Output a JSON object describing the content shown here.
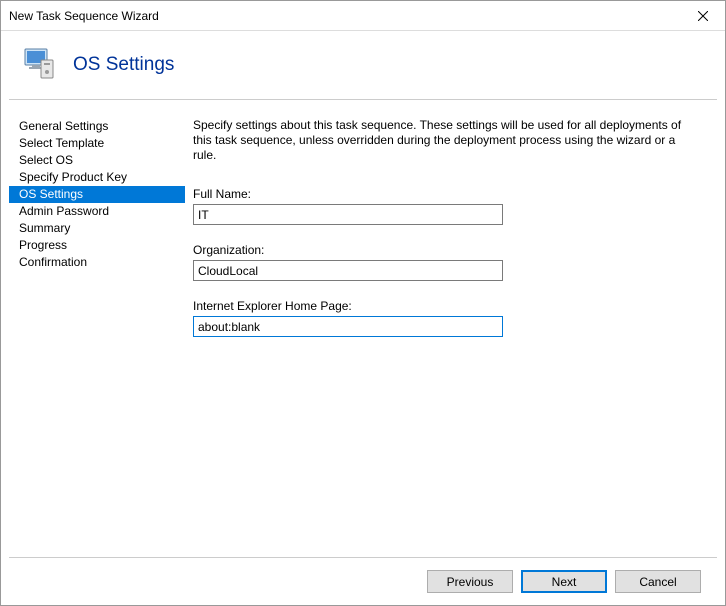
{
  "window": {
    "title": "New Task Sequence Wizard"
  },
  "header": {
    "title": "OS Settings"
  },
  "sidebar": {
    "items": [
      {
        "label": "General Settings",
        "active": false
      },
      {
        "label": "Select Template",
        "active": false
      },
      {
        "label": "Select OS",
        "active": false
      },
      {
        "label": "Specify Product Key",
        "active": false
      },
      {
        "label": "OS Settings",
        "active": true
      },
      {
        "label": "Admin Password",
        "active": false
      },
      {
        "label": "Summary",
        "active": false
      },
      {
        "label": "Progress",
        "active": false
      },
      {
        "label": "Confirmation",
        "active": false
      }
    ]
  },
  "main": {
    "instruction": "Specify settings about this task sequence.  These settings will be used for all deployments of this task sequence, unless overridden during the deployment process using the wizard or a rule.",
    "fields": {
      "full_name": {
        "label": "Full Name:",
        "value": "IT"
      },
      "organization": {
        "label": "Organization:",
        "value": "CloudLocal"
      },
      "ie_home": {
        "label": "Internet Explorer Home Page:",
        "value": "about:blank"
      }
    }
  },
  "footer": {
    "previous": "Previous",
    "next": "Next",
    "cancel": "Cancel"
  }
}
